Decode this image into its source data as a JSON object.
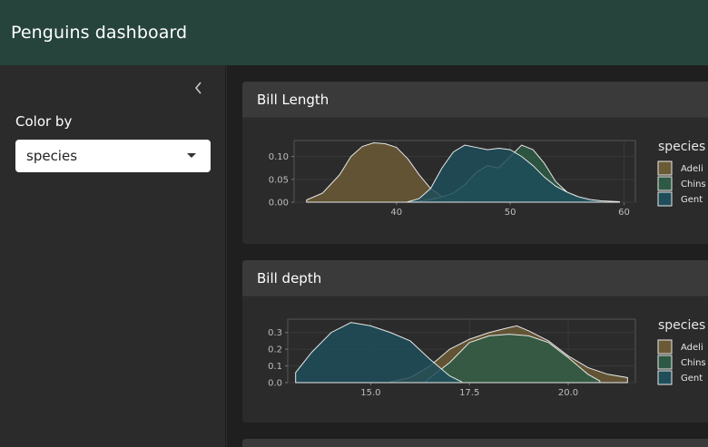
{
  "app": {
    "title": "Penguins dashboard"
  },
  "sidebar": {
    "collapse_icon": "chevron-left-icon",
    "color_by_label": "Color by",
    "color_by_value": "species"
  },
  "colors": {
    "navbar": "#26443c",
    "adelie": "#6b5a36",
    "chinstrap": "#2e5a45",
    "gentoo": "#1f4e5a"
  },
  "cards": [
    {
      "title": "Bill Length"
    },
    {
      "title": "Bill depth"
    }
  ],
  "chart_data": [
    {
      "type": "area",
      "title": "Bill Length",
      "xlabel": "",
      "ylabel": "",
      "xlim": [
        31,
        61
      ],
      "ylim": [
        0,
        0.135
      ],
      "x_ticks": [
        40,
        50,
        60
      ],
      "y_ticks": [
        0.0,
        0.05,
        0.1
      ],
      "y_tick_labels": [
        "0.00",
        "0.05",
        "0.10"
      ],
      "grid": true,
      "legend": {
        "title": "species",
        "position": "right",
        "entries": [
          "Adeli",
          "Chins",
          "Gent"
        ]
      },
      "series": [
        {
          "name": "Adeli",
          "x": [
            32.1,
            33.5,
            35,
            36,
            37,
            38,
            39,
            40,
            41,
            42,
            43,
            44,
            45,
            46
          ],
          "y": [
            0.005,
            0.02,
            0.06,
            0.1,
            0.122,
            0.13,
            0.128,
            0.12,
            0.095,
            0.06,
            0.03,
            0.012,
            0.004,
            0.001
          ]
        },
        {
          "name": "Chins",
          "x": [
            40.9,
            42,
            43,
            44,
            45,
            46,
            47,
            48,
            49,
            50,
            51,
            52,
            53,
            54,
            55,
            56,
            57,
            58
          ],
          "y": [
            0,
            0.002,
            0.006,
            0.012,
            0.02,
            0.038,
            0.065,
            0.08,
            0.075,
            0.1,
            0.125,
            0.115,
            0.085,
            0.045,
            0.022,
            0.01,
            0.004,
            0.001
          ]
        },
        {
          "name": "Gent",
          "x": [
            40.9,
            42,
            43,
            44,
            45,
            46,
            47,
            48,
            49,
            50,
            51,
            52,
            53,
            54,
            55,
            56,
            57,
            58,
            59.6
          ],
          "y": [
            0,
            0.008,
            0.03,
            0.075,
            0.11,
            0.125,
            0.12,
            0.115,
            0.118,
            0.115,
            0.1,
            0.08,
            0.055,
            0.035,
            0.022,
            0.012,
            0.006,
            0.003,
            0.001
          ]
        }
      ]
    },
    {
      "type": "area",
      "title": "Bill depth",
      "xlabel": "",
      "ylabel": "",
      "xlim": [
        12.9,
        21.7
      ],
      "ylim": [
        0,
        0.38
      ],
      "x_ticks": [
        15.0,
        17.5,
        20.0
      ],
      "x_tick_labels": [
        "15.0",
        "17.5",
        "20.0"
      ],
      "y_ticks": [
        0.0,
        0.1,
        0.2,
        0.3
      ],
      "y_tick_labels": [
        "0.0",
        "0.1",
        "0.2",
        "0.3"
      ],
      "grid": true,
      "legend": {
        "title": "species",
        "position": "right",
        "entries": [
          "Adeli",
          "Chins",
          "Gent"
        ]
      },
      "series": [
        {
          "name": "Adeli",
          "x": [
            15.5,
            16,
            16.5,
            17,
            17.5,
            18,
            18.5,
            18.7,
            19,
            19.5,
            20,
            20.5,
            21,
            21.5
          ],
          "y": [
            0.005,
            0.03,
            0.1,
            0.2,
            0.26,
            0.3,
            0.33,
            0.34,
            0.31,
            0.25,
            0.16,
            0.09,
            0.05,
            0.03
          ]
        },
        {
          "name": "Chins",
          "x": [
            16.4,
            17,
            17.5,
            18,
            18.5,
            19,
            19.5,
            20,
            20.5,
            20.8
          ],
          "y": [
            0.01,
            0.12,
            0.24,
            0.28,
            0.29,
            0.28,
            0.24,
            0.15,
            0.05,
            0.01
          ]
        },
        {
          "name": "Gent",
          "x": [
            13.1,
            13.5,
            14,
            14.5,
            15,
            15.5,
            16,
            16.5,
            17,
            17.3
          ],
          "y": [
            0.06,
            0.18,
            0.3,
            0.36,
            0.34,
            0.3,
            0.25,
            0.14,
            0.04,
            0.005
          ]
        }
      ]
    }
  ]
}
